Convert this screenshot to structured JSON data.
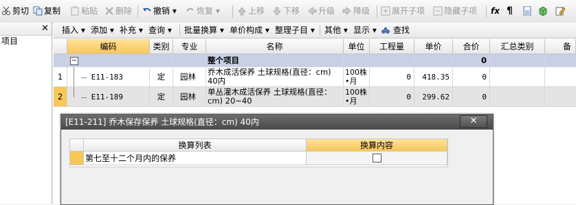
{
  "toolbar": {
    "cut": "剪切",
    "copy": "复制",
    "paste": "粘贴",
    "delete": "删除",
    "undo": "撤销",
    "redo": "恢复",
    "move_up": "上移",
    "move_down": "下移",
    "upgrade": "升级",
    "downgrade": "降级",
    "expand": "展开子项",
    "hide": "隐藏子项",
    "fx": "fx",
    "para": "¶"
  },
  "left_panel": {
    "close": "✕",
    "item": "项目"
  },
  "toolbar2": {
    "insert": "插入",
    "add": "添加",
    "supplement": "补充",
    "query": "查询",
    "batch_convert": "批量换算",
    "unit_price_composition": "单价构成",
    "organize_children": "整理子目",
    "other": "其他",
    "display": "显示",
    "find": "查找"
  },
  "grid": {
    "headers": [
      "编码",
      "类别",
      "专业",
      "名称",
      "单位",
      "工程量",
      "单价",
      "合价",
      "汇总类别",
      "备注"
    ],
    "group_row": {
      "toggle": "−",
      "name": "整个项目",
      "total": "0"
    },
    "rows": [
      {
        "num": "1",
        "code": "E11-183",
        "category": "定",
        "specialty": "园林",
        "name": "乔木成活保养 土球规格(直径：cm) 40内",
        "unit": "100株•月",
        "quantity": "0",
        "price": "418.35",
        "total": "0"
      },
      {
        "num": "2",
        "code": "E11-189",
        "category": "定",
        "specialty": "园林",
        "name": "单丛灌木成活保养 土球规格(直径：cm) 20~40",
        "unit": "100株•月",
        "quantity": "0",
        "price": "299.62",
        "total": "0"
      }
    ]
  },
  "dialog": {
    "title": "[E11-211] 乔木保存保养 土球规格(直径：cm) 40内",
    "close": "✕",
    "col_list": "换算列表",
    "col_content": "换算内容",
    "row_label": "第七至十二个月内的保养"
  },
  "colors": {
    "accent": "#f7c75a",
    "header_bg": "#e9e9e9",
    "dialog_title": "#4a4a4a"
  }
}
